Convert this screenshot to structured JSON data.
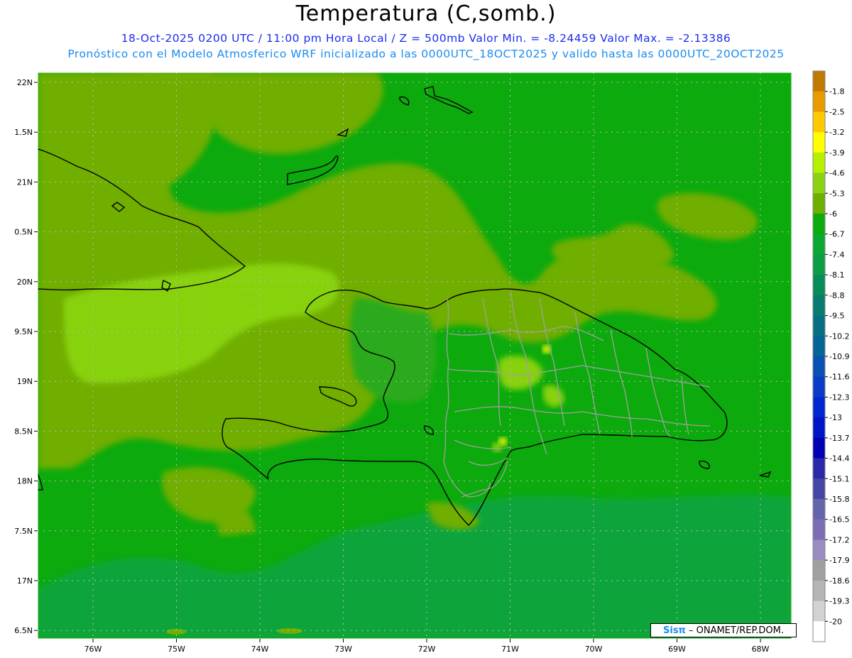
{
  "header": {
    "title": "Temperatura (C,somb.)",
    "subtitle_line1": "18-Oct-2025  0200 UTC / 11:00 pm Hora Local / Z = 500mb  Valor Min. = -8.24459  Valor Max. = -2.13386",
    "subtitle_line2": "Pronóstico con el Modelo Atmosferico WRF inicializado a las 0000UTC_18OCT2025 y valido hasta las  0000UTC_20OCT2025"
  },
  "map": {
    "lat_ticks": [
      "22N",
      "1.5N",
      "21N",
      "0.5N",
      "20N",
      "9.5N",
      "19N",
      "8.5N",
      "18N",
      "7.5N",
      "17N",
      "6.5N"
    ],
    "lon_ticks": [
      "76W",
      "75W",
      "74W",
      "73W",
      "72W",
      "71W",
      "70W",
      "69W",
      "68W"
    ],
    "colors": {
      "ocean_base": "#0caa0c",
      "light_field": "#6fae00",
      "lighter_field": "#88d20f",
      "dark_field": "#09a53a",
      "coast": "#000000",
      "provinces": "#a0a0a0"
    }
  },
  "colorbar": {
    "labels": [
      "-1.8",
      "-2.5",
      "-3.2",
      "-3.9",
      "-4.6",
      "-5.3",
      "-6",
      "-6.7",
      "-7.4",
      "-8.1",
      "-8.8",
      "-9.5",
      "-10.2",
      "-10.9",
      "-11.6",
      "-12.3",
      "-13",
      "-13.7",
      "-14.4",
      "-15.1",
      "-15.8",
      "-16.5",
      "-17.2",
      "-17.9",
      "-18.6",
      "-19.3",
      "-20"
    ],
    "colors": [
      "#c07a00",
      "#e89a00",
      "#ffc800",
      "#ffff00",
      "#b4f000",
      "#8cd214",
      "#6eaf00",
      "#0caa0c",
      "#0aaa32",
      "#0a9e46",
      "#088c5a",
      "#087c6e",
      "#067082",
      "#046496",
      "#0a50b4",
      "#0a3cc8",
      "#0028d2",
      "#0014c8",
      "#0000b4",
      "#2828aa",
      "#4646a6",
      "#6464ac",
      "#7c6eb4",
      "#9a8cc0",
      "#a0a0a0",
      "#b4b4b4",
      "#d2d2d2",
      "#ffffff"
    ]
  },
  "credit": {
    "brand": "Sisπ",
    "separator": " – ",
    "org": "ONAMET/REP.DOM."
  }
}
